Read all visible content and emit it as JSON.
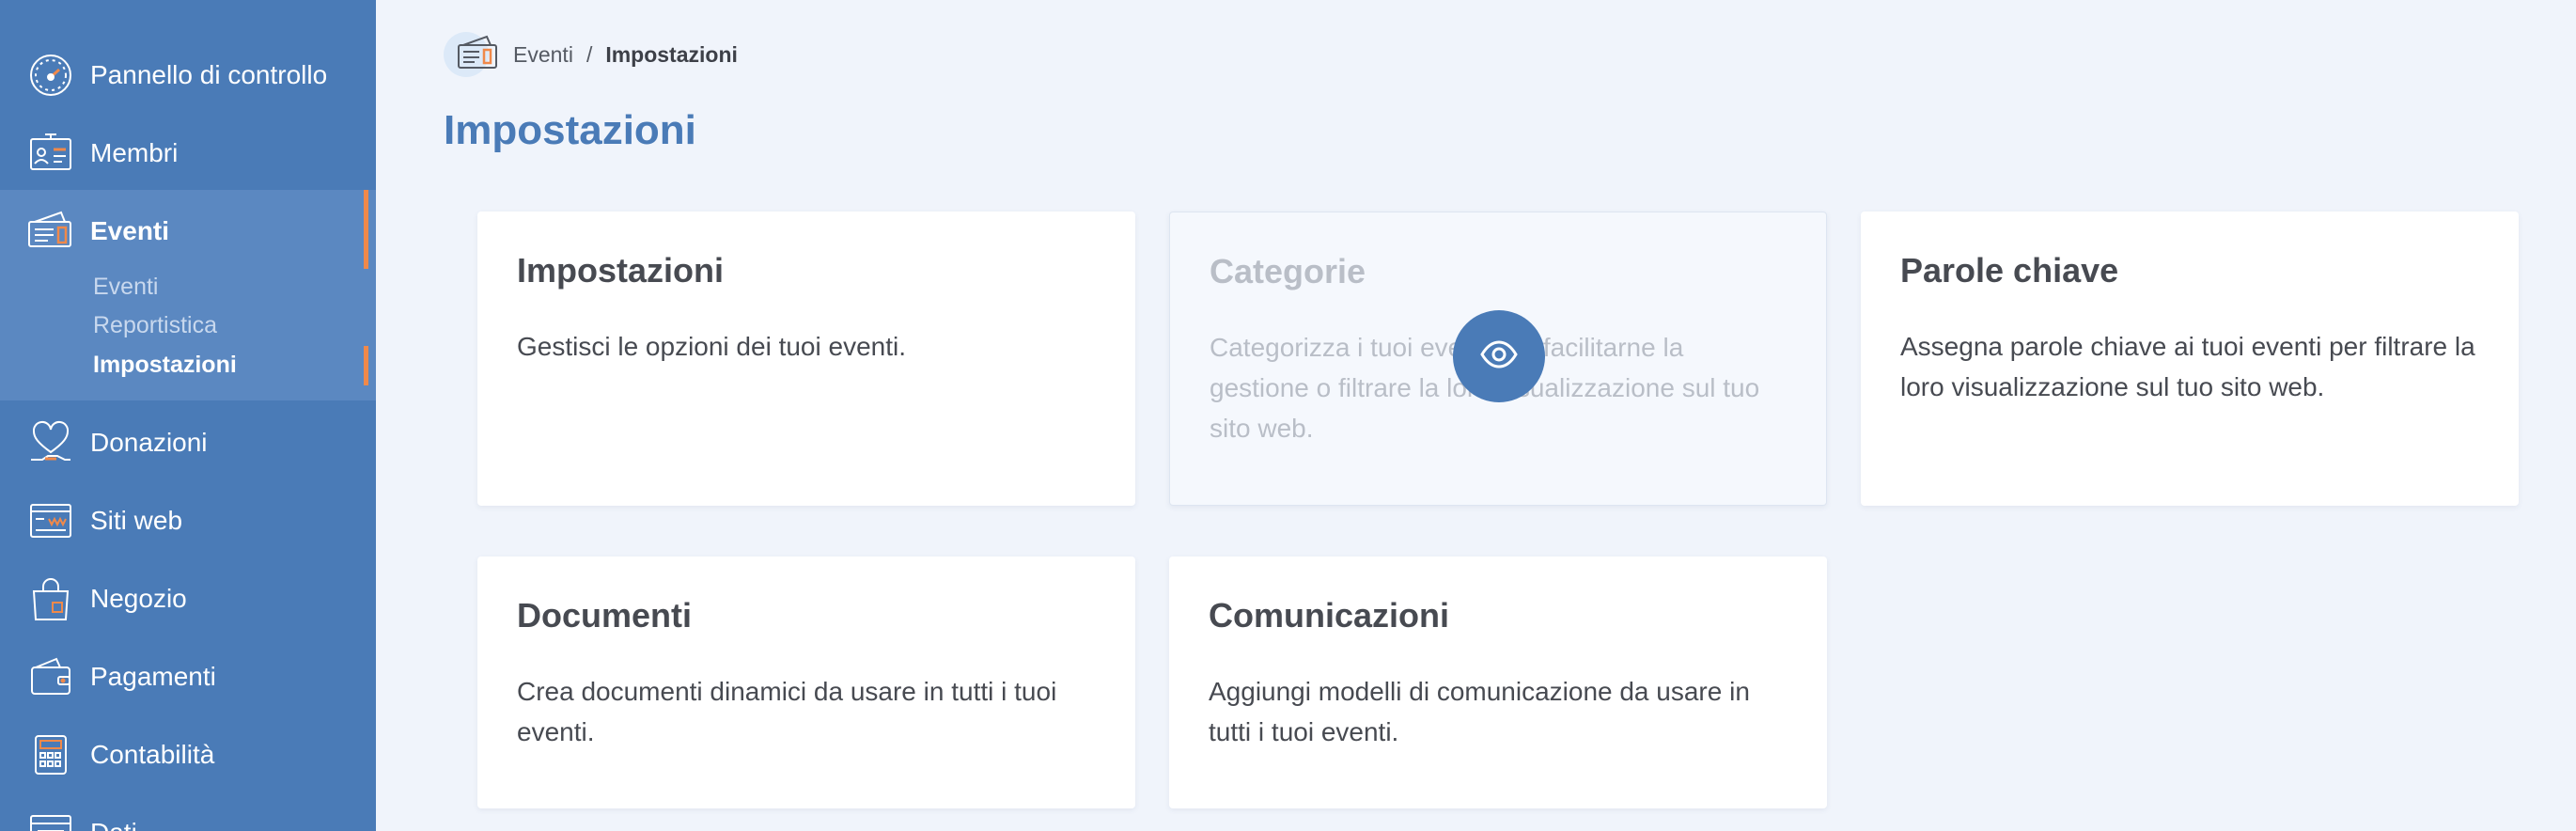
{
  "sidebar": {
    "items": [
      {
        "label": "Pannello di controllo",
        "icon": "dashboard-gauge-icon"
      },
      {
        "label": "Membri",
        "icon": "member-card-icon"
      },
      {
        "label": "Eventi",
        "icon": "event-tickets-icon"
      },
      {
        "label": "Donazioni",
        "icon": "donation-heart-icon"
      },
      {
        "label": "Siti web",
        "icon": "website-icon"
      },
      {
        "label": "Negozio",
        "icon": "shopping-bag-icon"
      },
      {
        "label": "Pagamenti",
        "icon": "wallet-icon"
      },
      {
        "label": "Contabilità",
        "icon": "calculator-icon"
      },
      {
        "label": "Dati",
        "icon": "data-icon"
      }
    ],
    "eventi_subitems": [
      "Eventi",
      "Reportistica",
      "Impostazioni"
    ],
    "active_item": "Eventi",
    "active_subitem": "Impostazioni"
  },
  "breadcrumb": {
    "icon": "event-tickets-icon",
    "parent": "Eventi",
    "separator": "/",
    "current": "Impostazioni"
  },
  "page": {
    "title": "Impostazioni"
  },
  "cards": [
    {
      "title": "Impostazioni",
      "description": "Gestisci le opzioni dei tuoi eventi."
    },
    {
      "title": "Categorie",
      "description": "Categorizza i tuoi eventi per facilitarne la gestione o filtrare la loro visualizzazione sul tuo sito web."
    },
    {
      "title": "Parole chiave",
      "description": "Assegna parole chiave ai tuoi eventi per filtrare la loro visualizzazione sul tuo sito web."
    },
    {
      "title": "Documenti",
      "description": "Crea documenti dinamici da usare in tutti i tuoi eventi."
    },
    {
      "title": "Comunicazioni",
      "description": "Aggiungi modelli di comunicazione da usare in tutti i tuoi eventi."
    }
  ],
  "colors": {
    "sidebar_bg": "#4a7bb7",
    "sidebar_active_bg": "#5b88c1",
    "accent_orange": "#f0894a",
    "title_blue": "#4a7bb7",
    "page_bg": "#f0f4fb"
  },
  "overlay": {
    "icon": "eye-icon"
  }
}
